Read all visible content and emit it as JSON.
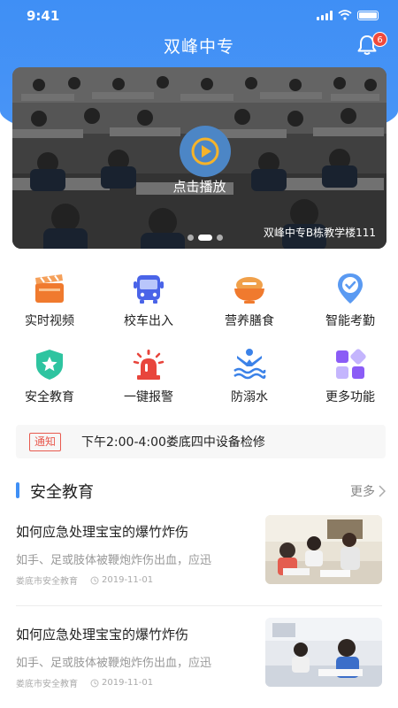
{
  "status_bar": {
    "time": "9:41"
  },
  "header": {
    "title": "双峰中专",
    "notification_count": "6"
  },
  "video": {
    "play_label": "点击播放",
    "caption": "双峰中专B栋教学楼111"
  },
  "features": [
    {
      "label": "实时视频",
      "icon": "video-clapper-icon"
    },
    {
      "label": "校车出入",
      "icon": "bus-icon"
    },
    {
      "label": "营养膳食",
      "icon": "food-bowl-icon"
    },
    {
      "label": "智能考勤",
      "icon": "location-check-icon"
    },
    {
      "label": "安全教育",
      "icon": "shield-star-icon"
    },
    {
      "label": "一键报警",
      "icon": "alarm-siren-icon"
    },
    {
      "label": "防溺水",
      "icon": "swimmer-icon"
    },
    {
      "label": "更多功能",
      "icon": "more-grid-icon"
    }
  ],
  "notice": {
    "tag": "通知",
    "text": "下午2:00-4:00娄底四中设备检修"
  },
  "section": {
    "title": "安全教育",
    "more_label": "更多"
  },
  "articles": [
    {
      "title": "如何应急处理宝宝的爆竹炸伤",
      "summary": "如手、足或肢体被鞭炮炸伤出血，应迅",
      "source": "娄底市安全教育",
      "date": "2019-11-01"
    },
    {
      "title": "如何应急处理宝宝的爆竹炸伤",
      "summary": "如手、足或肢体被鞭炮炸伤出血，应迅",
      "source": "娄底市安全教育",
      "date": "2019-11-01"
    }
  ],
  "colors": {
    "primary": "#3f8ff5",
    "badge": "#f04a3c",
    "notice_tag": "#e85a4f"
  }
}
